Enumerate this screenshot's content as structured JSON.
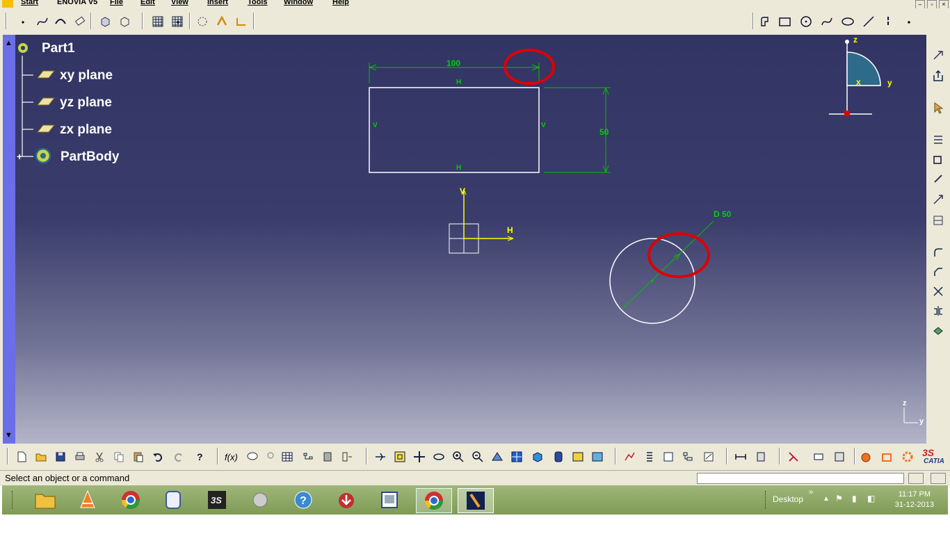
{
  "menu": {
    "start": "Start",
    "enovia": "ENOVIA V5",
    "items": [
      "File",
      "Edit",
      "View",
      "Insert",
      "Tools",
      "Window",
      "Help"
    ]
  },
  "tree": {
    "root": "Part1",
    "planes": [
      "xy plane",
      "yz plane",
      "zx plane"
    ],
    "body": "PartBody"
  },
  "sketch": {
    "dim_width": "100",
    "dim_height": "50",
    "dim_diameter": "D 50",
    "h_label": "H",
    "v_label": "V",
    "axis_h": "H",
    "axis_v": "V"
  },
  "compass": {
    "z": "z",
    "x": "x",
    "y": "y"
  },
  "corner_axis": {
    "z": "z",
    "y": "y"
  },
  "statusbar": {
    "message": "Select an object or a command"
  },
  "taskbar": {
    "desktop_label": "Desktop",
    "time": "11:17 PM",
    "date": "31-12-2013"
  },
  "brand": {
    "catia": "CATIA"
  },
  "colors": {
    "viewport_top": "#323463",
    "dimension": "#00cc00",
    "constraint": "#00cc00",
    "axis": "#ffff00",
    "highlight": "#dd0000",
    "sketch": "#ffffff"
  }
}
